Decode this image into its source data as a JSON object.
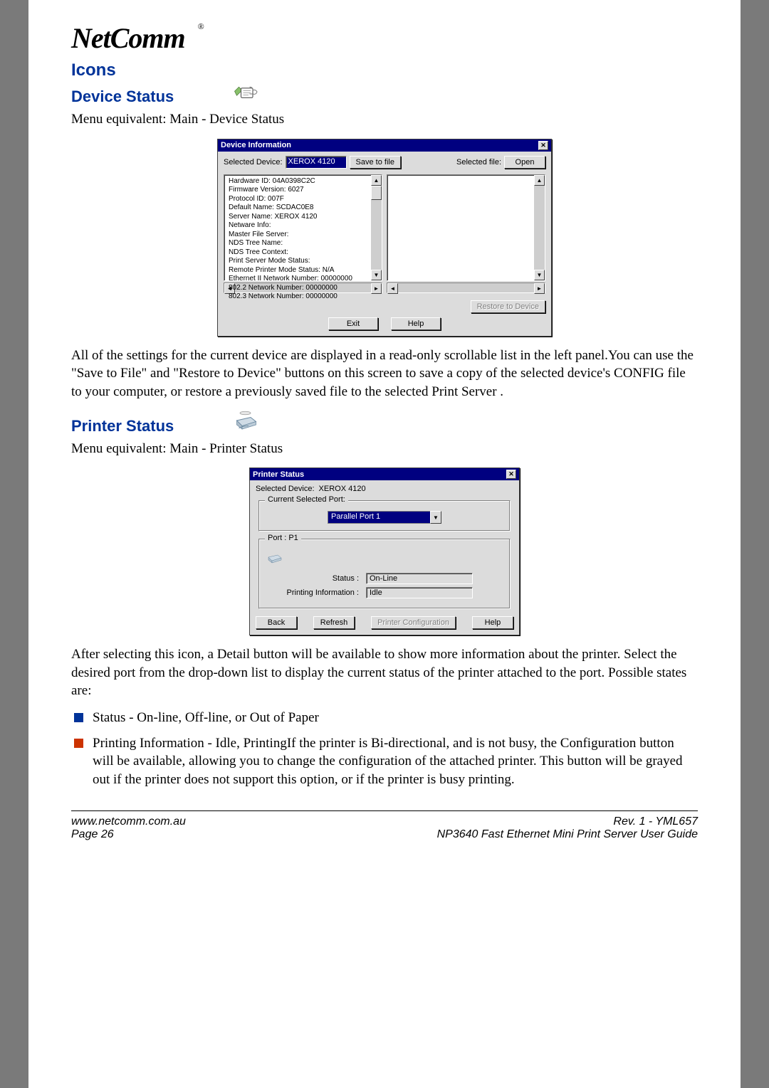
{
  "logo_text": "NetComm",
  "section_icons": "Icons",
  "device_status": {
    "heading": "Device Status",
    "menu_equivalent": "Menu equivalent: Main - Device Status",
    "dialog": {
      "title": "Device Information",
      "selected_device_label": "Selected Device:",
      "selected_device_value": "XEROX 4120",
      "save_to_file": "Save to file",
      "selected_file_label": "Selected file:",
      "open": "Open",
      "info_lines": [
        "Hardware ID: 04A0398C2C",
        "Firmware Version: 6027",
        "Protocol ID: 007F",
        "Default Name: SCDAC0E8",
        "Server Name: XEROX 4120",
        "Netware Info:",
        "  Master File Server:",
        "  NDS Tree Name:",
        "  NDS Tree Context:",
        "  Print Server Mode Status:",
        "  Remote Printer Mode Status: N/A",
        "  Ethernet II Network Number: 00000000",
        "  802.2 Network Number: 00000000",
        "  802.3 Network Number: 00000000"
      ],
      "restore_button": "Restore to Device",
      "exit": "Exit",
      "help": "Help"
    },
    "description": "All of the settings for the current device are displayed in a read-only scrollable list in the left panel.You can use the \"Save to File\" and \"Restore to Device\" buttons on this screen to save a copy of the selected device's CONFIG file to your computer, or restore a previously saved file to the selected Print Server ."
  },
  "printer_status": {
    "heading": "Printer Status",
    "menu_equivalent": "Menu equivalent: Main - Printer Status",
    "dialog": {
      "title": "Printer Status",
      "selected_device_label": "Selected Device:",
      "selected_device_value": "XEROX 4120",
      "current_port_group": "Current Selected Port:",
      "port_dropdown_value": "Parallel Port 1",
      "port_group_label": "Port : P1",
      "status_label": "Status :",
      "status_value": "On-Line",
      "printing_info_label": "Printing Information :",
      "printing_info_value": "Idle",
      "back": "Back",
      "refresh": "Refresh",
      "printer_config": "Printer Configuration",
      "help": "Help"
    },
    "description": "After selecting this icon, a Detail button will be available to show more information about the printer. Select the desired port from the drop-down list to display the current status of the printer attached to the port. Possible states are:",
    "bullets": [
      "Status - On-line, Off-line, or Out of Paper",
      "Printing Information - Idle, PrintingIf the printer is Bi-directional, and is not busy, the Configuration button will be available, allowing you to change the configuration of the attached printer. This button will be grayed out if the printer does not support this option, or if the printer is busy printing."
    ]
  },
  "footer": {
    "url": "www.netcomm.com.au",
    "page": "Page 26",
    "rev": "Rev. 1 - YML657",
    "guide": "NP3640  Fast Ethernet Mini Print Server User Guide"
  }
}
